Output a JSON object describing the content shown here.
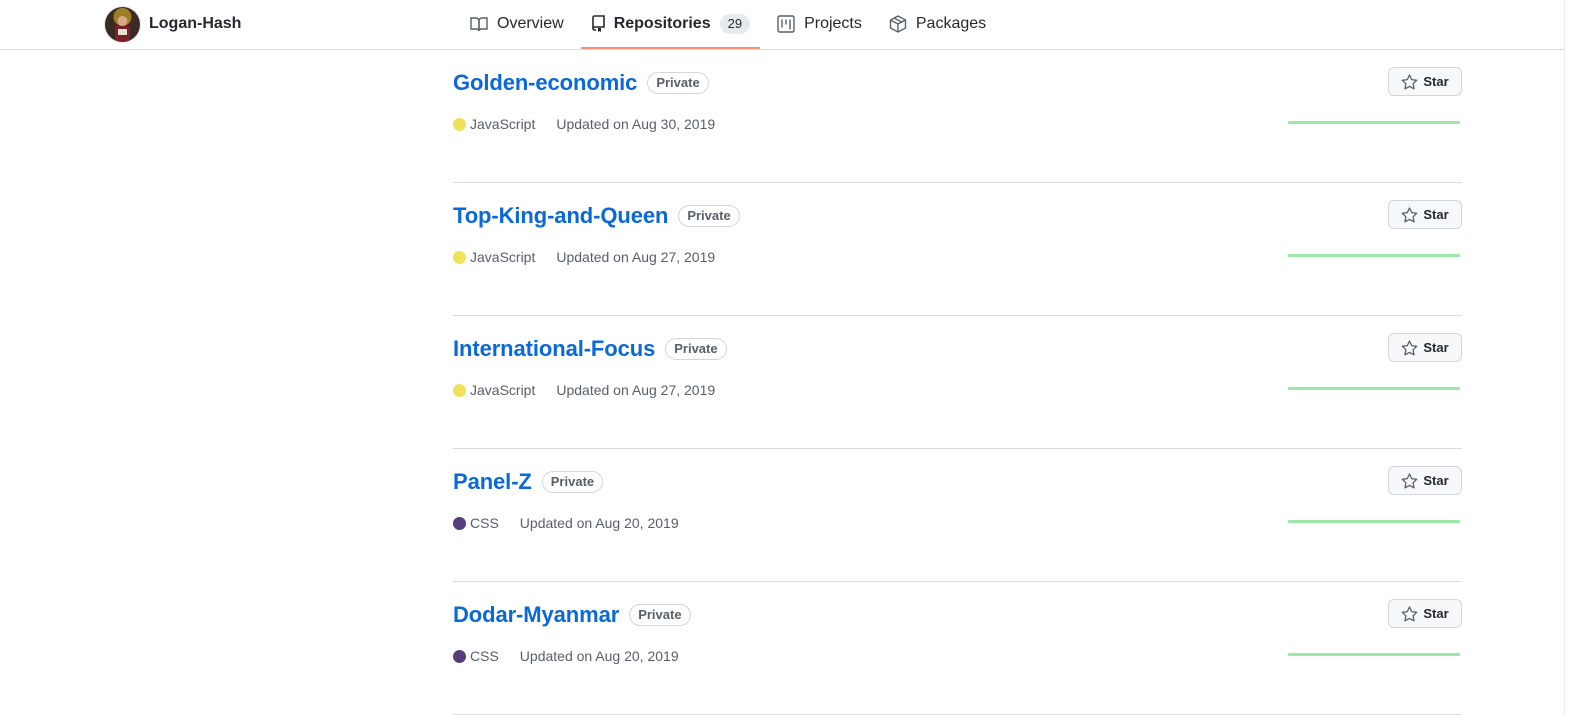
{
  "header": {
    "username": "Logan-Hash",
    "tabs": [
      {
        "label": "Overview",
        "icon": "book-icon"
      },
      {
        "label": "Repositories",
        "icon": "repo-icon",
        "count": "29",
        "active": true
      },
      {
        "label": "Projects",
        "icon": "project-icon"
      },
      {
        "label": "Packages",
        "icon": "package-icon"
      }
    ]
  },
  "colors": {
    "link": "#0969da",
    "active_tab_underline": "#fd8c73",
    "javascript": "#f1e05a",
    "css": "#563d7c",
    "sparkline": "#9be9a8"
  },
  "repos": [
    {
      "name": "Golden-economic",
      "visibility": "Private",
      "language": "JavaScript",
      "lang_color": "#f1e05a",
      "updated": "Updated on Aug 30, 2019",
      "star_label": "Star"
    },
    {
      "name": "Top-King-and-Queen",
      "visibility": "Private",
      "language": "JavaScript",
      "lang_color": "#f1e05a",
      "updated": "Updated on Aug 27, 2019",
      "star_label": "Star"
    },
    {
      "name": "International-Focus",
      "visibility": "Private",
      "language": "JavaScript",
      "lang_color": "#f1e05a",
      "updated": "Updated on Aug 27, 2019",
      "star_label": "Star"
    },
    {
      "name": "Panel-Z",
      "visibility": "Private",
      "language": "CSS",
      "lang_color": "#563d7c",
      "updated": "Updated on Aug 20, 2019",
      "star_label": "Star"
    },
    {
      "name": "Dodar-Myanmar",
      "visibility": "Private",
      "language": "CSS",
      "lang_color": "#563d7c",
      "updated": "Updated on Aug 20, 2019",
      "star_label": "Star"
    }
  ]
}
